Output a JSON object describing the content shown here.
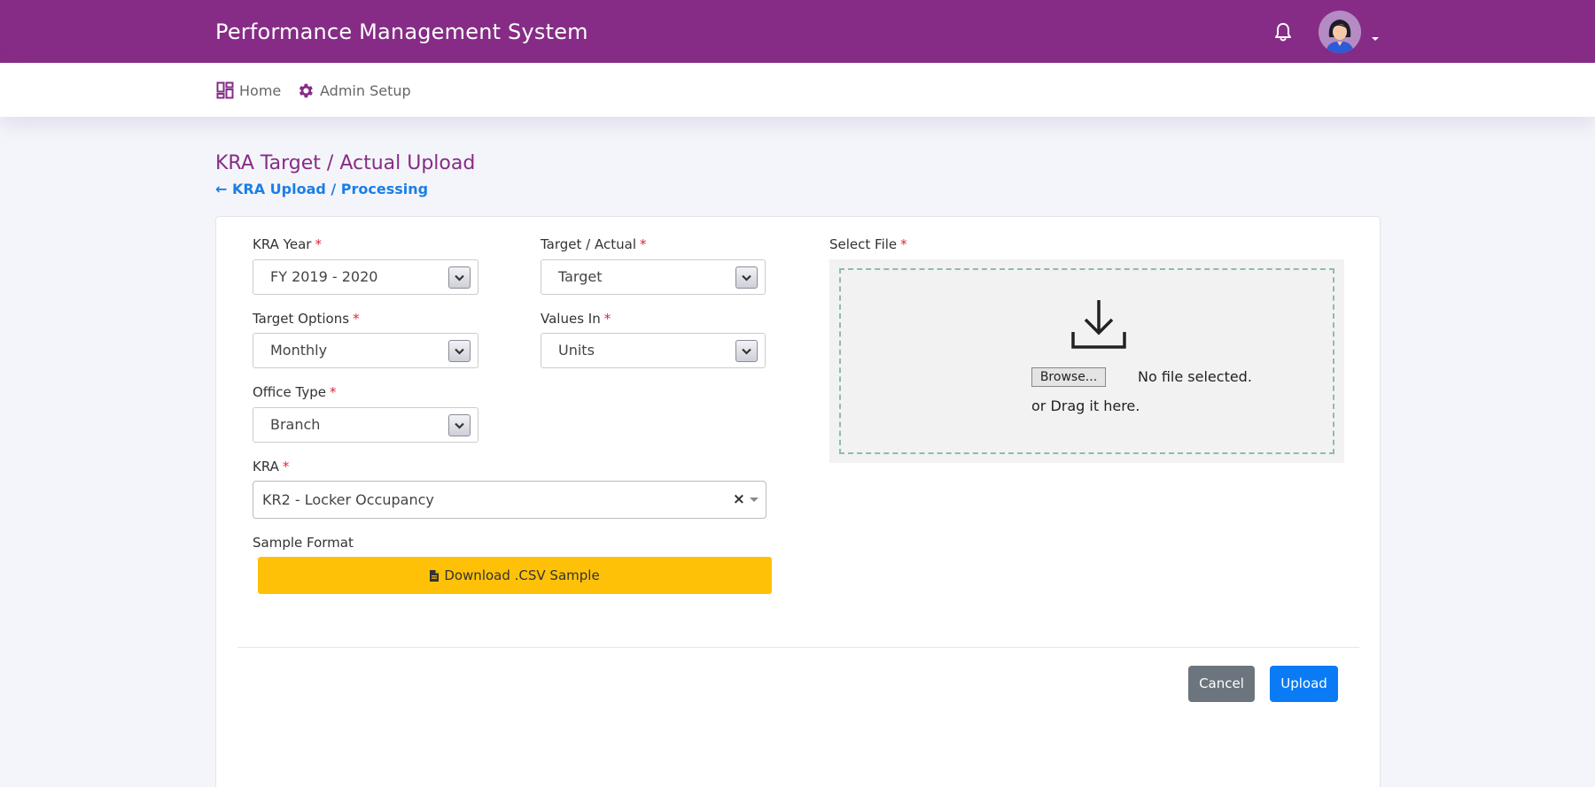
{
  "header": {
    "title": "Performance Management System",
    "icons": {
      "notifications": "bell-icon",
      "profile": "avatar-icon",
      "menu": "chevron-down-icon"
    }
  },
  "nav": {
    "items": [
      {
        "label": "Home",
        "icon": "dashboard-icon"
      },
      {
        "label": "Admin Setup",
        "icon": "gear-icon"
      }
    ]
  },
  "page": {
    "title": "KRA Target / Actual Upload",
    "breadcrumb": "← KRA Upload / Processing"
  },
  "form": {
    "required_mark": "*",
    "kra_year": {
      "label": "KRA Year",
      "value": "FY 2019 - 2020"
    },
    "target_actual": {
      "label": "Target / Actual",
      "value": "Target"
    },
    "target_options": {
      "label": "Target Options",
      "value": "Monthly"
    },
    "values_in": {
      "label": "Values In",
      "value": "Units"
    },
    "office_type": {
      "label": "Office Type",
      "value": "Branch"
    },
    "kra": {
      "label": "KRA",
      "value": "KR2  -  Locker Occupancy",
      "clear": "×"
    },
    "sample_format": {
      "label": "Sample Format",
      "button_label": "Download .CSV Sample",
      "icon": "file-csv-icon",
      "button_color": "#ffc107"
    },
    "select_file": {
      "label": "Select File",
      "browse_label": "Browse...",
      "status": "No file selected.",
      "drag_text": "or Drag it here.",
      "icon": "download-icon"
    }
  },
  "actions": {
    "cancel_label": "Cancel",
    "upload_label": "Upload"
  },
  "colors": {
    "brand": "#862c86",
    "link": "#1a7fe6",
    "required": "#e0243a",
    "primary": "#0a7bf5",
    "secondary": "#6c757d",
    "warning": "#ffc107"
  }
}
